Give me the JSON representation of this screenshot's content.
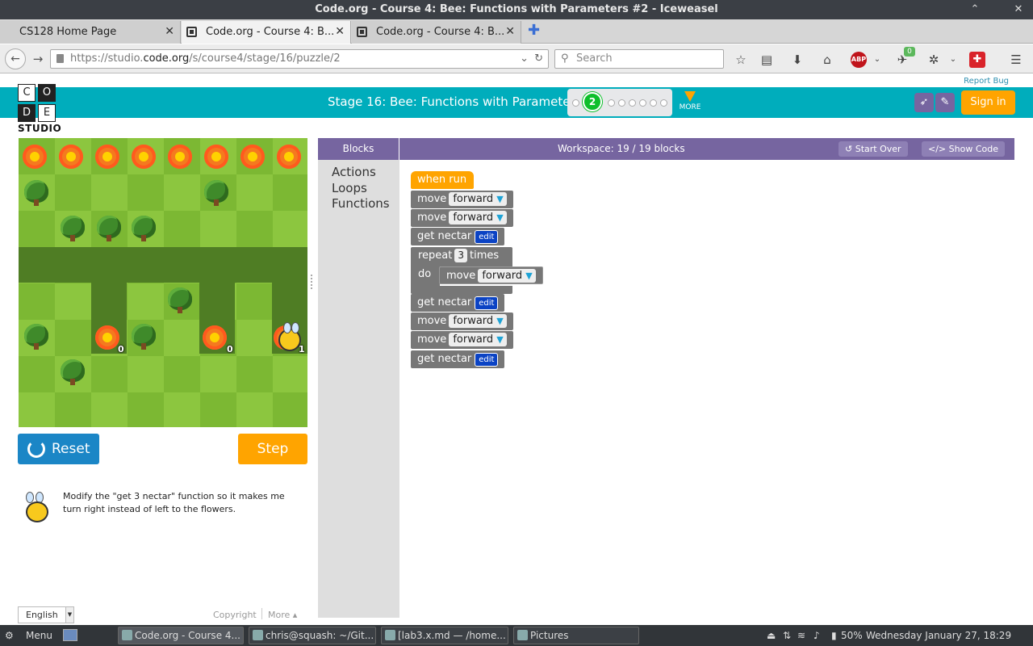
{
  "window": {
    "title": "Code.org - Course 4: Bee: Functions with Parameters #2 - Iceweasel"
  },
  "tabs": [
    {
      "label": "CS128 Home Page"
    },
    {
      "label": "Code.org - Course 4: B..."
    },
    {
      "label": "Code.org - Course 4: B..."
    }
  ],
  "nav": {
    "url_prefix": "https://studio.",
    "url_domain": "code.org",
    "url_path": "/s/course4/stage/16/puzzle/2",
    "search_placeholder": "Search",
    "abp_label": "ABP",
    "addon_badge": "0"
  },
  "header": {
    "report_bug": "Report Bug",
    "logo_letters": [
      "C",
      "O",
      "D",
      "E"
    ],
    "logo_sub": "STUDIO",
    "stage_title": "Stage 16: Bee: Functions with Parameters",
    "current_puzzle": "2",
    "more_label": "MORE",
    "signin_label": "Sign in"
  },
  "game": {
    "flower_counts": [
      "0",
      "0",
      "1"
    ]
  },
  "controls": {
    "reset_label": "Reset",
    "step_label": "Step"
  },
  "instructions": {
    "text": "Modify the \"get 3 nectar\" function so it makes me turn right instead of left to the flowers."
  },
  "footer": {
    "language": "English",
    "copyright": "Copyright",
    "more": "More ▴"
  },
  "editor": {
    "blocks_label": "Blocks",
    "workspace_label": "Workspace: 19 / 19 blocks",
    "start_over": "Start Over",
    "show_code": "Show Code",
    "categories": [
      "Actions",
      "Loops",
      "Functions"
    ],
    "program": {
      "when_run": "when run",
      "move": "move",
      "forward": "forward",
      "get_nectar": "get nectar",
      "edit": "edit",
      "repeat": "repeat",
      "repeat_count": "3",
      "times": "times",
      "do": "do"
    }
  },
  "taskbar": {
    "menu": "Menu",
    "items": [
      {
        "label": "Code.org - Course 4..."
      },
      {
        "label": "chris@squash: ~/Git..."
      },
      {
        "label": "[lab3.x.md — /home..."
      },
      {
        "label": "Pictures"
      }
    ],
    "battery": "50%",
    "datetime": "Wednesday January 27, 18:29"
  }
}
